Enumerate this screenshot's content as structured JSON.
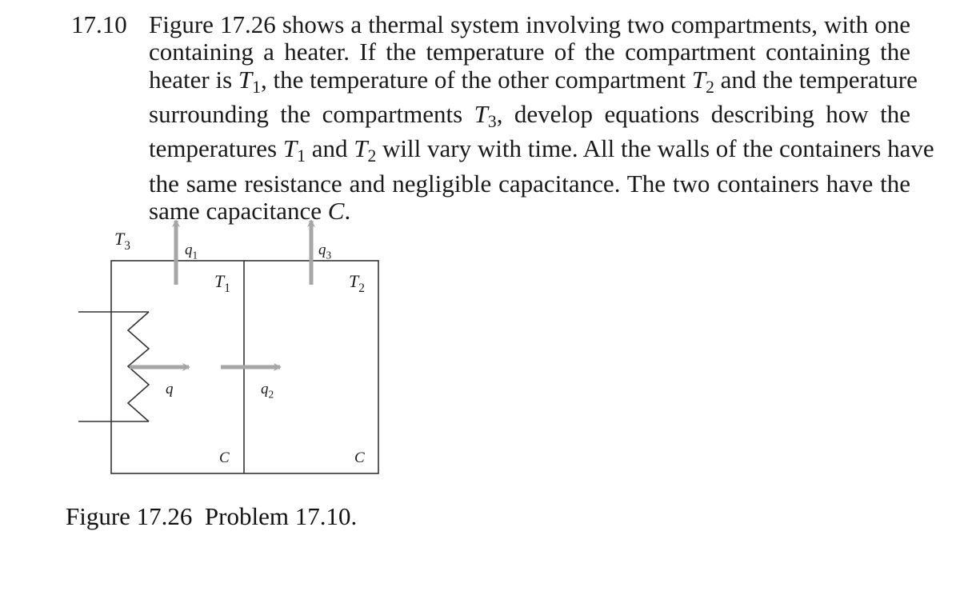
{
  "problem": {
    "number": "17.10",
    "lines": [
      [
        "Figure 17.26 shows a thermal system involving two compartments, with one"
      ],
      [
        "containing a heater. If the temperature of the compartment containing the"
      ],
      [
        "heater is ",
        {
          "var": "T",
          "sub": "1"
        },
        ", the temperature of the other compartment ",
        {
          "var": "T",
          "sub": "2"
        },
        " and the temperature"
      ],
      [
        "surrounding the compartments ",
        {
          "var": "T",
          "sub": "3"
        },
        ", develop equations describing how the"
      ],
      [
        "temperatures ",
        {
          "var": "T",
          "sub": "1"
        },
        " and ",
        {
          "var": "T",
          "sub": "2"
        },
        " will vary with time. All the walls of the containers have"
      ],
      [
        "the same resistance and negligible capacitance. The two containers have the"
      ],
      [
        "same capacitance ",
        {
          "var": "C",
          "sub": ""
        },
        "."
      ]
    ]
  },
  "figure": {
    "labels": {
      "T3": {
        "var": "T",
        "sub": "3"
      },
      "T1": {
        "var": "T",
        "sub": "1"
      },
      "T2": {
        "var": "T",
        "sub": "2"
      },
      "q1": {
        "var": "q",
        "sub": "1"
      },
      "q3": {
        "var": "q",
        "sub": "3"
      },
      "q": {
        "var": "q",
        "sub": ""
      },
      "q2": {
        "var": "q",
        "sub": "2"
      },
      "C_left": {
        "var": "C",
        "sub": ""
      },
      "C_right": {
        "var": "C",
        "sub": ""
      }
    },
    "colors": {
      "line": "#333333",
      "arrow": "#a6a6a6",
      "label": "#1a1a1a"
    }
  },
  "caption": "Figure 17.26  Problem 17.10."
}
